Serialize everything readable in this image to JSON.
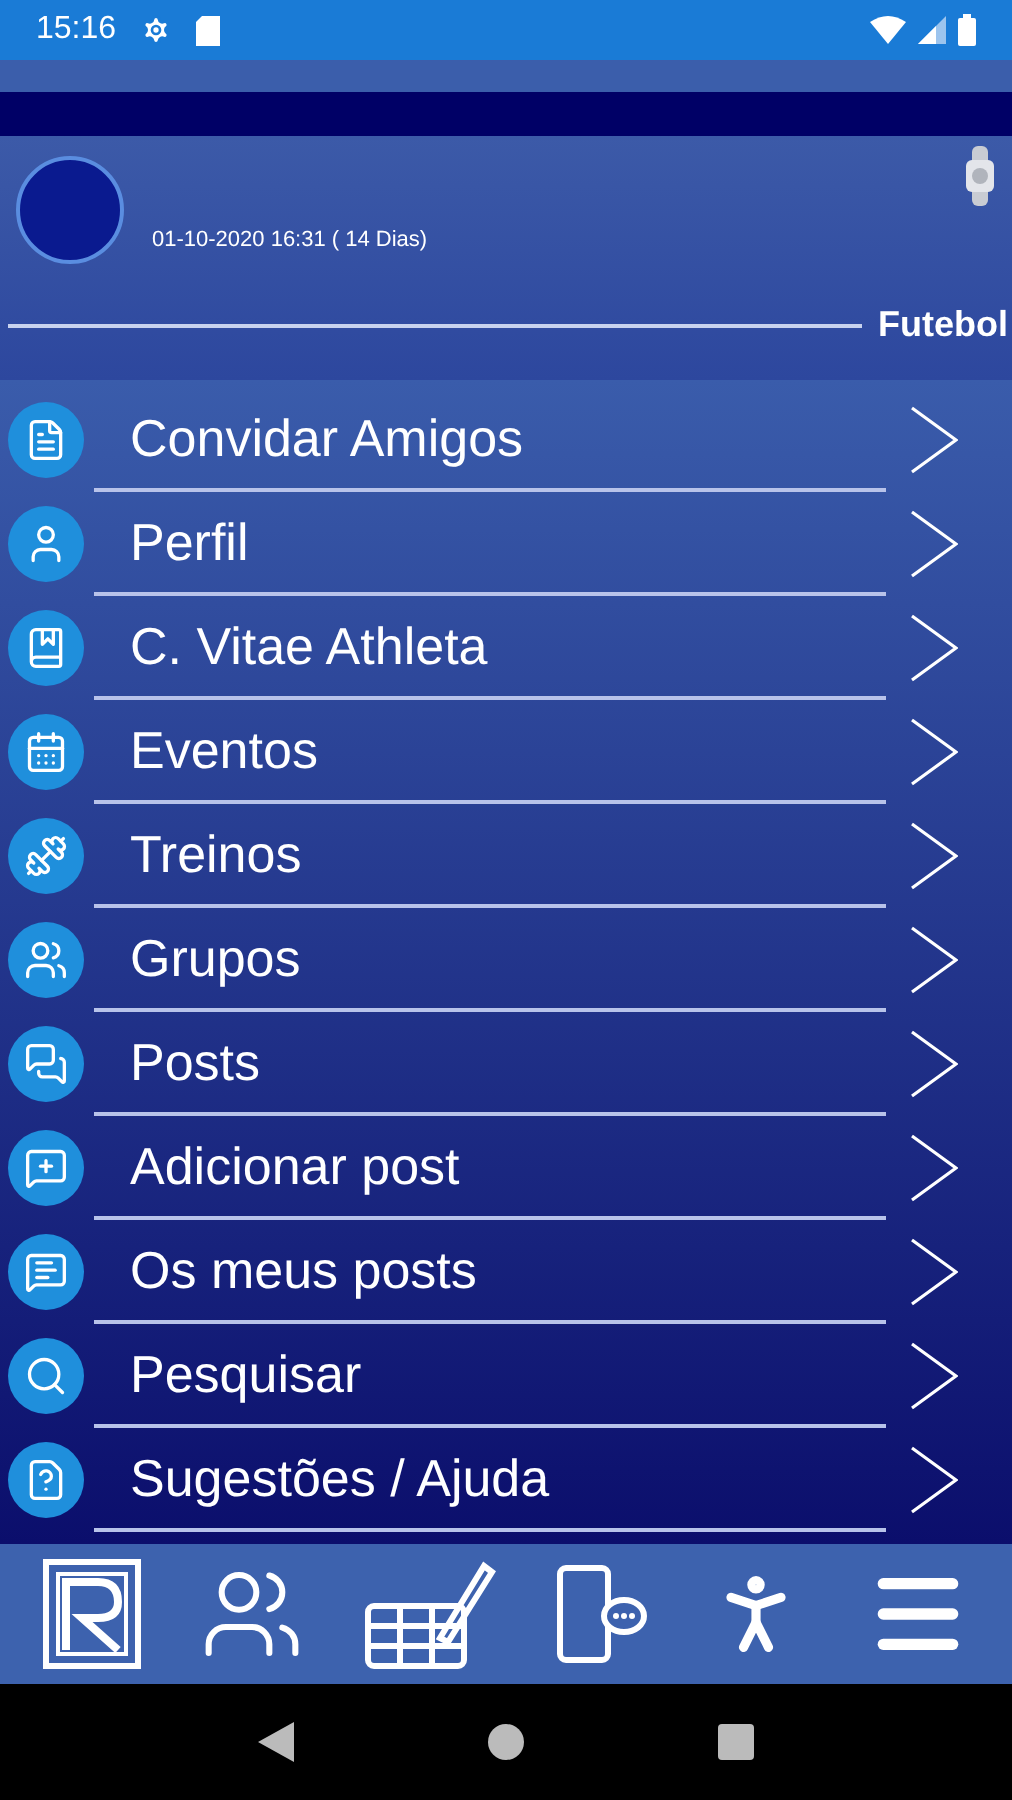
{
  "status_bar": {
    "time": "15:16"
  },
  "header": {
    "date": "01-10-2020 16:31 ( 14 Dias)",
    "sport": "Futebol"
  },
  "menu": [
    {
      "label": "Convidar Amigos"
    },
    {
      "label": "Perfil"
    },
    {
      "label": "C. Vitae Athleta"
    },
    {
      "label": "Eventos"
    },
    {
      "label": "Treinos"
    },
    {
      "label": "Grupos"
    },
    {
      "label": "Posts"
    },
    {
      "label": "Adicionar post"
    },
    {
      "label": "Os meus posts"
    },
    {
      "label": "Pesquisar"
    },
    {
      "label": "Sugestões / Ajuda"
    }
  ]
}
